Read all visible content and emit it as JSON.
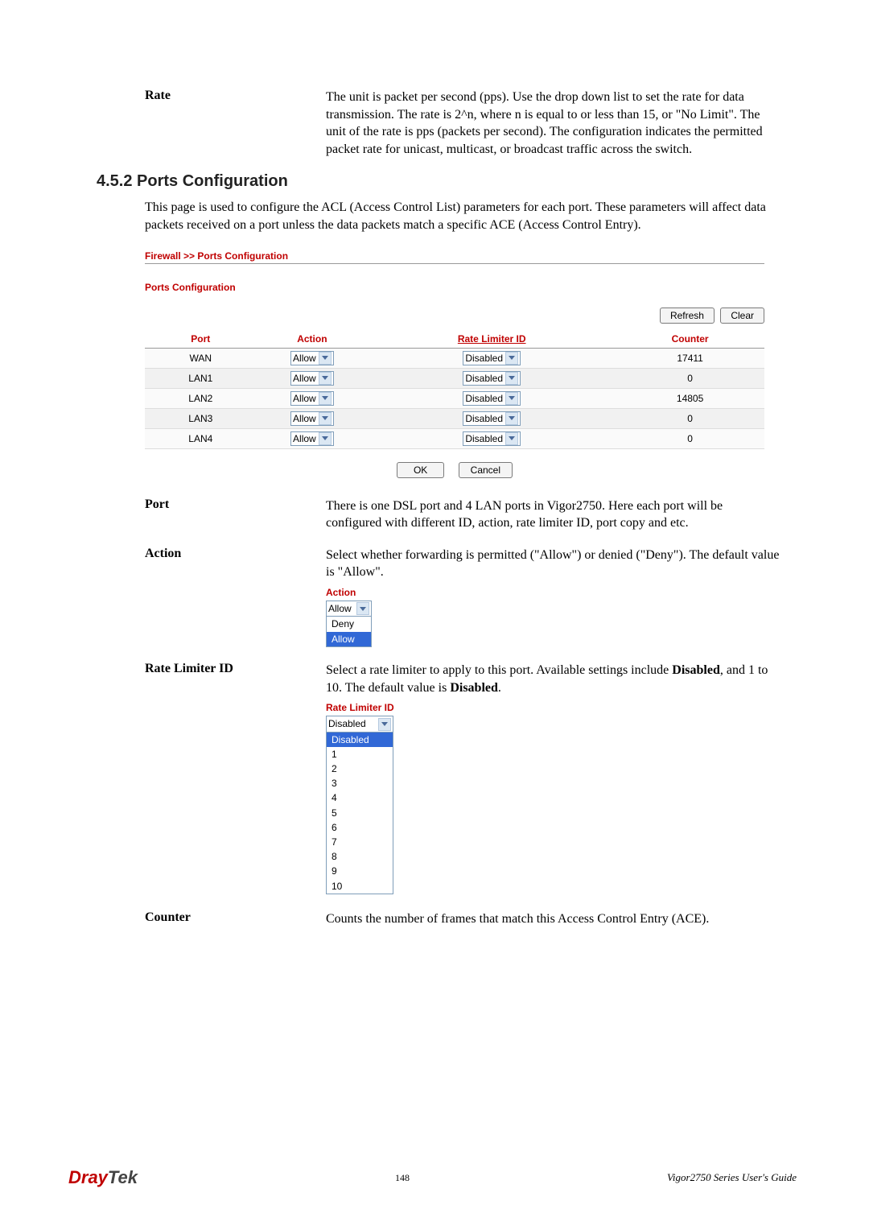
{
  "terms": {
    "rate": {
      "label": "Rate",
      "desc": "The unit is packet per second (pps). Use the drop down list to set the rate for data transmission. The rate is 2^n, where n is equal to or less than 15, or \"No Limit\". The unit of the rate is pps (packets per second). The configuration indicates the permitted packet rate for unicast, multicast, or broadcast traffic across the switch."
    },
    "port": {
      "label": "Port",
      "desc": "There is one DSL port and 4 LAN ports in Vigor2750. Here each port will be configured with different ID, action, rate limiter ID, port copy and etc."
    },
    "action": {
      "label": "Action",
      "desc": "Select whether forwarding is permitted (\"Allow\") or denied (\"Deny\"). The default value is \"Allow\".",
      "widget_label": "Action",
      "selected": "Allow",
      "options": [
        "Deny",
        "Allow"
      ]
    },
    "rateLimiter": {
      "label": "Rate Limiter ID",
      "desc_pre": "Select a rate limiter to apply to this port. Available settings include ",
      "desc_b1": "Disabled",
      "desc_mid": ", and 1 to 10. The default value is ",
      "desc_b2": "Disabled",
      "desc_post": ".",
      "widget_label": "Rate Limiter ID",
      "selected": "Disabled",
      "options": [
        "Disabled",
        "1",
        "2",
        "3",
        "4",
        "5",
        "6",
        "7",
        "8",
        "9",
        "10"
      ]
    },
    "counter": {
      "label": "Counter",
      "desc": "Counts the number of frames that match this Access Control Entry (ACE)."
    }
  },
  "section": {
    "heading": "4.5.2 Ports Configuration",
    "intro": "This page is used to configure the ACL (Access Control List) parameters for each port. These parameters will affect data packets received on a port unless the data packets match a specific ACE (Access Control Entry)."
  },
  "ui": {
    "breadcrumb": "Firewall >> Ports Configuration",
    "subtitle": "Ports Configuration",
    "buttons": {
      "refresh": "Refresh",
      "clear": "Clear",
      "ok": "OK",
      "cancel": "Cancel"
    },
    "columns": {
      "port": "Port",
      "action": "Action",
      "rateLimiter": "Rate Limiter ID",
      "counter": "Counter"
    },
    "rows": [
      {
        "port": "WAN",
        "action": "Allow",
        "rateLimiter": "Disabled",
        "counter": "17411"
      },
      {
        "port": "LAN1",
        "action": "Allow",
        "rateLimiter": "Disabled",
        "counter": "0"
      },
      {
        "port": "LAN2",
        "action": "Allow",
        "rateLimiter": "Disabled",
        "counter": "14805"
      },
      {
        "port": "LAN3",
        "action": "Allow",
        "rateLimiter": "Disabled",
        "counter": "0"
      },
      {
        "port": "LAN4",
        "action": "Allow",
        "rateLimiter": "Disabled",
        "counter": "0"
      }
    ]
  },
  "footer": {
    "logo1": "Dray",
    "logo2": "Tek",
    "page": "148",
    "guide": "Vigor2750  Series  User's  Guide"
  }
}
